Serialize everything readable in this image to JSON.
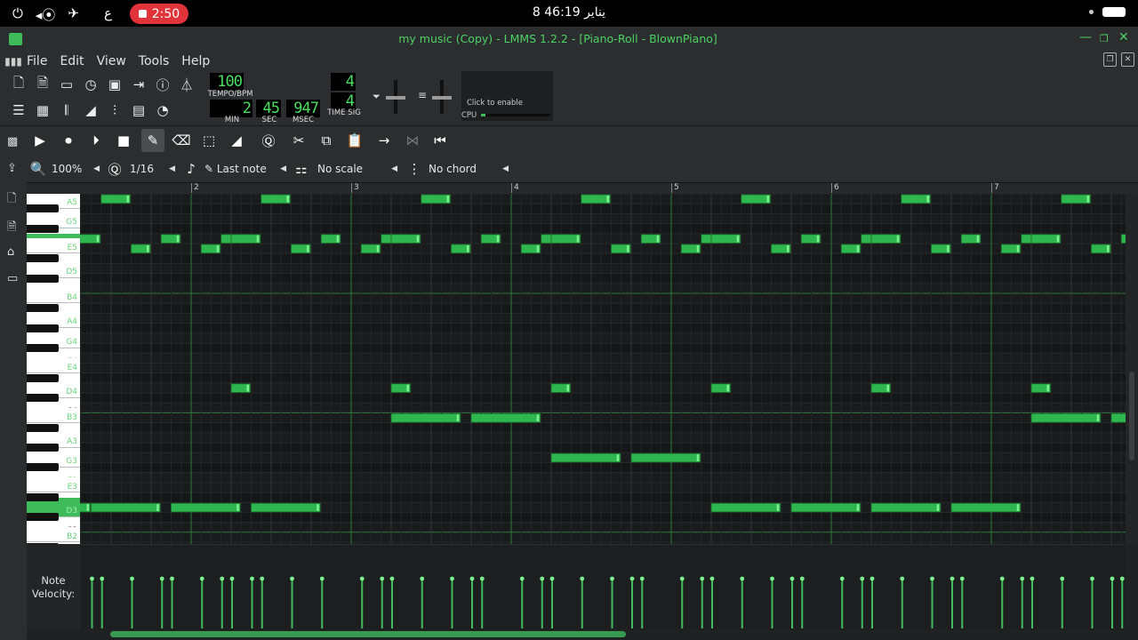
{
  "statusbar": {
    "left_glyph": "ع",
    "timer": "2:50",
    "clock": "8 يناير 46:19"
  },
  "window": {
    "title": "my music (Copy) - LMMS 1.2.2 - [Piano-Roll - BlownPiano]"
  },
  "menu": {
    "items": [
      "File",
      "Edit",
      "View",
      "Tools",
      "Help"
    ]
  },
  "transport": {
    "tempo": "100",
    "tempo_label": "TEMPO/BPM",
    "min": "2",
    "sec": "45",
    "msec": "947",
    "min_label": "MIN",
    "sec_label": "SEC",
    "msec_label": "MSEC",
    "timesig_num": "4",
    "timesig_den": "4",
    "timesig_label": "TIME SIG",
    "cpu_hint": "Click to enable",
    "cpu_label": "CPU",
    "cpu_level": 0.07
  },
  "pianoroll": {
    "zoom": "100%",
    "quantize": "1/16",
    "note_length": "Last note",
    "scale": "No scale",
    "chord": "No chord",
    "timeline_bars": [
      "2",
      "3",
      "4",
      "5",
      "6",
      "7"
    ],
    "keys": [
      {
        "label": "A5",
        "highlight": false
      },
      {
        "label": "G5",
        "highlight": false
      },
      {
        "label": "F5",
        "highlight": true
      },
      {
        "label": "E5",
        "highlight": false
      },
      {
        "label": "D5",
        "highlight": false
      },
      {
        "label": "C5",
        "highlight": false
      },
      {
        "label": "B4",
        "highlight": false
      },
      {
        "label": "A4",
        "highlight": false
      },
      {
        "label": "G4",
        "highlight": false
      },
      {
        "label": "F4",
        "highlight": false
      },
      {
        "label": "E4",
        "highlight": false
      },
      {
        "label": "D4",
        "highlight": false
      },
      {
        "label": "C4",
        "highlight": false
      },
      {
        "label": "B3",
        "highlight": false
      },
      {
        "label": "A3",
        "highlight": false
      },
      {
        "label": "G3",
        "highlight": false
      },
      {
        "label": "F3",
        "highlight": false
      },
      {
        "label": "E3",
        "highlight": false
      },
      {
        "label": "D3",
        "highlight": true
      },
      {
        "label": "C3",
        "highlight": false
      },
      {
        "label": "B2",
        "highlight": false
      }
    ],
    "velocity_label": "Note Velocity:"
  },
  "colors": {
    "accent": "#3fbb5b",
    "note_fill": "#2fb74f",
    "note_border": "#7df08f",
    "grid_bg": "#191b1c"
  },
  "icons": {
    "toolbar1": [
      "new-project-icon",
      "new-template-icon",
      "open-project-icon",
      "recent-projects-icon",
      "save-icon",
      "export-icon",
      "about-icon",
      "metronome-icon"
    ],
    "toolbar2": [
      "song-editor-icon",
      "beat-bassline-icon",
      "piano-roll-icon",
      "automation-icon",
      "fx-mixer-icon",
      "project-notes-icon",
      "controller-rack-icon"
    ],
    "piano_tools": [
      "play-icon",
      "record-icon",
      "record-play-icon",
      "stop-icon",
      "draw-icon",
      "erase-icon",
      "select-icon",
      "pitch-bend-icon",
      "detune-icon",
      "cut-icon",
      "copy-icon",
      "paste-icon",
      "step-forward-icon",
      "step-record-icon",
      "rewind-icon"
    ]
  }
}
